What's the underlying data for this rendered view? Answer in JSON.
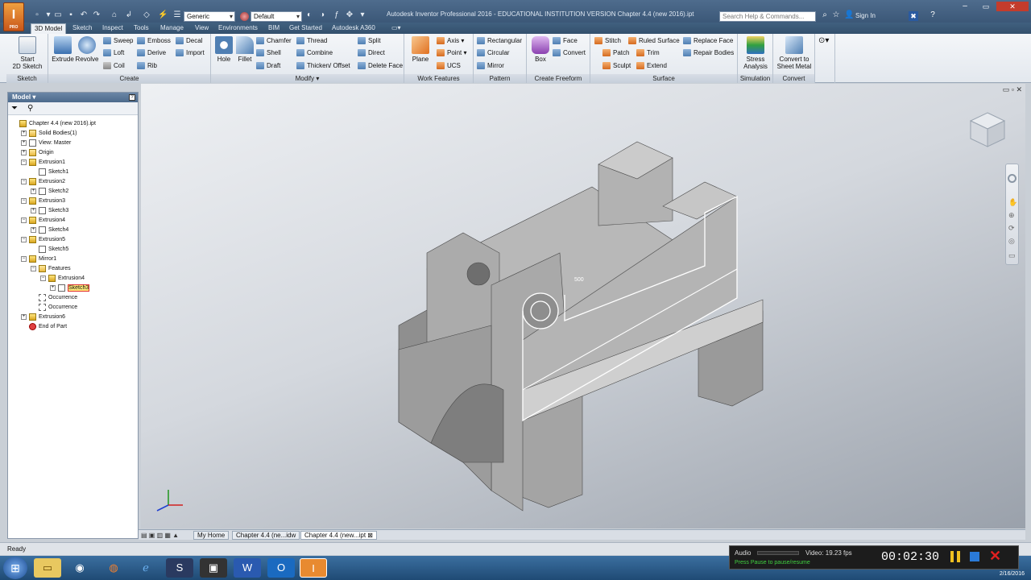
{
  "app": {
    "window_title": "Autodesk Inventor Professional 2016 - EDUCATIONAL INSTITUTION VERSION     Chapter 4.4 (new 2016).ipt",
    "logo_letter": "I",
    "logo_sub": "PRO",
    "material_combo": "Generic",
    "appearance_combo": "Default",
    "help_search_placeholder": "Search Help & Commands...",
    "sign_in": "Sign In"
  },
  "ribbon_tabs": [
    "3D Model",
    "Sketch",
    "Inspect",
    "Tools",
    "Manage",
    "View",
    "Environments",
    "BIM",
    "Get Started",
    "Autodesk A360"
  ],
  "ribbon": {
    "sketch": {
      "title": "Sketch",
      "start": "Start\n2D Sketch"
    },
    "create": {
      "title": "Create",
      "extrude": "Extrude",
      "revolve": "Revolve",
      "sweep": "Sweep",
      "emboss": "Emboss",
      "decal": "Decal",
      "loft": "Loft",
      "derive": "Derive",
      "import": "Import",
      "coil": "Coil",
      "rib": "Rib"
    },
    "modify": {
      "title": "Modify ▾",
      "hole": "Hole",
      "fillet": "Fillet",
      "chamfer": "Chamfer",
      "thread": "Thread",
      "split": "Split",
      "shell": "Shell",
      "combine": "Combine",
      "direct": "Direct",
      "draft": "Draft",
      "thicken": "Thicken/ Offset",
      "delete_face": "Delete Face"
    },
    "work": {
      "title": "Work Features",
      "plane": "Plane",
      "axis": "Axis ▾",
      "point": "Point ▾",
      "ucs": "UCS"
    },
    "pattern": {
      "title": "Pattern",
      "rectangular": "Rectangular",
      "circular": "Circular",
      "mirror": "Mirror"
    },
    "freeform": {
      "title": "Create Freeform",
      "box": "Box",
      "face": "Face",
      "convert": "Convert"
    },
    "surface": {
      "title": "Surface",
      "stitch": "Stitch",
      "ruled": "Ruled Surface",
      "replace": "Replace Face",
      "patch": "Patch",
      "trim": "Trim",
      "repair": "Repair Bodies",
      "sculpt": "Sculpt",
      "extend": "Extend"
    },
    "simulation": {
      "title": "Simulation",
      "stress": "Stress\nAnalysis"
    },
    "convert": {
      "title": "Convert",
      "sheet": "Convert to\nSheet Metal"
    }
  },
  "browser": {
    "header": "Model ▾",
    "items": [
      {
        "label": "Chapter 4.4 (new 2016).ipt",
        "level": 0,
        "icon": "part",
        "expander": ""
      },
      {
        "label": "Solid Bodies(1)",
        "level": 1,
        "icon": "folder",
        "expander": "+"
      },
      {
        "label": "View: Master",
        "level": 1,
        "icon": "sketch",
        "expander": "+"
      },
      {
        "label": "Origin",
        "level": 1,
        "icon": "folder",
        "expander": "+"
      },
      {
        "label": "Extrusion1",
        "level": 1,
        "icon": "part",
        "expander": "−"
      },
      {
        "label": "Sketch1",
        "level": 2,
        "icon": "sketch",
        "expander": ""
      },
      {
        "label": "Extrusion2",
        "level": 1,
        "icon": "part",
        "expander": "−"
      },
      {
        "label": "Sketch2",
        "level": 2,
        "icon": "sketch",
        "expander": "+"
      },
      {
        "label": "Extrusion3",
        "level": 1,
        "icon": "part",
        "expander": "−"
      },
      {
        "label": "Sketch3",
        "level": 2,
        "icon": "sketch",
        "expander": "+"
      },
      {
        "label": "Extrusion4",
        "level": 1,
        "icon": "part",
        "expander": "−"
      },
      {
        "label": "Sketch4",
        "level": 2,
        "icon": "sketch",
        "expander": "+"
      },
      {
        "label": "Extrusion5",
        "level": 1,
        "icon": "part",
        "expander": "−"
      },
      {
        "label": "Sketch5",
        "level": 2,
        "icon": "sketch",
        "expander": ""
      },
      {
        "label": "Mirror1",
        "level": 1,
        "icon": "part",
        "expander": "−"
      },
      {
        "label": "Features",
        "level": 2,
        "icon": "folder",
        "expander": "−"
      },
      {
        "label": "Extrusion4",
        "level": 3,
        "icon": "part",
        "expander": "−"
      },
      {
        "label": "Sketch3",
        "level": 4,
        "icon": "sketch",
        "expander": "+",
        "selected": true
      },
      {
        "label": "Occurrence",
        "level": 2,
        "icon": "occ",
        "expander": ""
      },
      {
        "label": "Occurrence",
        "level": 2,
        "icon": "occ",
        "expander": ""
      },
      {
        "label": "Extrusion6",
        "level": 1,
        "icon": "part",
        "expander": "+"
      },
      {
        "label": "End of Part",
        "level": 1,
        "icon": "end",
        "expander": ""
      }
    ]
  },
  "viewport": {
    "dimension_label": "500"
  },
  "doc_tabs": [
    "My Home",
    "Chapter 4.4 (ne...idw",
    "Chapter 4.4 (new...ipt"
  ],
  "status": "Ready",
  "recorder": {
    "audio": "Audio",
    "video": "Video: 19.23 fps",
    "time": "00:02:30",
    "hint": "Press Pause to pause/resume"
  },
  "taskbar": {
    "date": "2/16/2016"
  }
}
